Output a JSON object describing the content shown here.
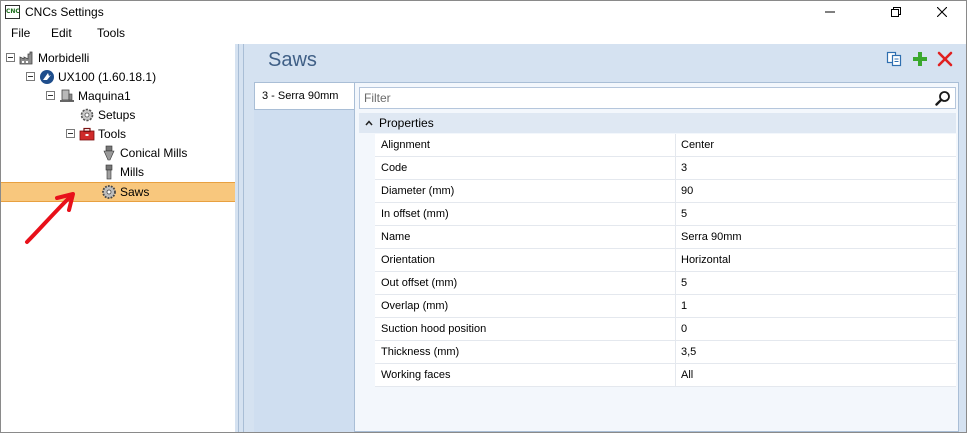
{
  "window": {
    "title": "CNCs Settings",
    "icon_text": "CNC",
    "controls": [
      "minimize-icon",
      "maximize-icon",
      "close-icon"
    ]
  },
  "menu": {
    "items": [
      "File",
      "Edit",
      "Tools"
    ]
  },
  "tree": {
    "nodes": [
      {
        "label": "Morbidelli",
        "icon": "factory-icon",
        "level": 0,
        "expanded": true
      },
      {
        "label": "UX100 (1.60.18.1)",
        "icon": "machine-logo-icon",
        "level": 1,
        "expanded": true
      },
      {
        "label": "Maquina1",
        "icon": "machine-icon",
        "level": 2,
        "expanded": true
      },
      {
        "label": "Setups",
        "icon": "gear-icon",
        "level": 3,
        "expanded": false
      },
      {
        "label": "Tools",
        "icon": "toolbox-icon",
        "level": 3,
        "expanded": true
      },
      {
        "label": "Conical Mills",
        "icon": "conical-mill-icon",
        "level": 4,
        "expanded": false
      },
      {
        "label": "Mills",
        "icon": "mill-icon",
        "level": 4,
        "expanded": false
      },
      {
        "label": "Saws",
        "icon": "saw-icon",
        "level": 4,
        "expanded": false,
        "selected": true
      }
    ]
  },
  "panel": {
    "title": "Saws",
    "actions": [
      "copy-icon",
      "add-icon",
      "delete-icon"
    ],
    "tabs": [
      {
        "label": "3 - Serra 90mm",
        "active": true
      }
    ],
    "filter": {
      "placeholder": "Filter",
      "value": ""
    },
    "category": "Properties",
    "properties": [
      {
        "name": "Alignment",
        "value": "Center"
      },
      {
        "name": "Code",
        "value": "3"
      },
      {
        "name": "Diameter (mm)",
        "value": "90"
      },
      {
        "name": "In offset (mm)",
        "value": "5"
      },
      {
        "name": "Name",
        "value": "Serra 90mm"
      },
      {
        "name": "Orientation",
        "value": "Horizontal"
      },
      {
        "name": "Out offset (mm)",
        "value": "5"
      },
      {
        "name": "Overlap (mm)",
        "value": "1"
      },
      {
        "name": "Suction hood position",
        "value": "0"
      },
      {
        "name": "Thickness (mm)",
        "value": "3,5"
      },
      {
        "name": "Working faces",
        "value": "All"
      }
    ]
  },
  "colors": {
    "selection": "#f8c77d",
    "panel_bg": "#d5e2f1",
    "title_blue": "#3f5f86",
    "annotation_red": "#e8101a",
    "add_green": "#3aa82e",
    "delete_red": "#e02020"
  }
}
